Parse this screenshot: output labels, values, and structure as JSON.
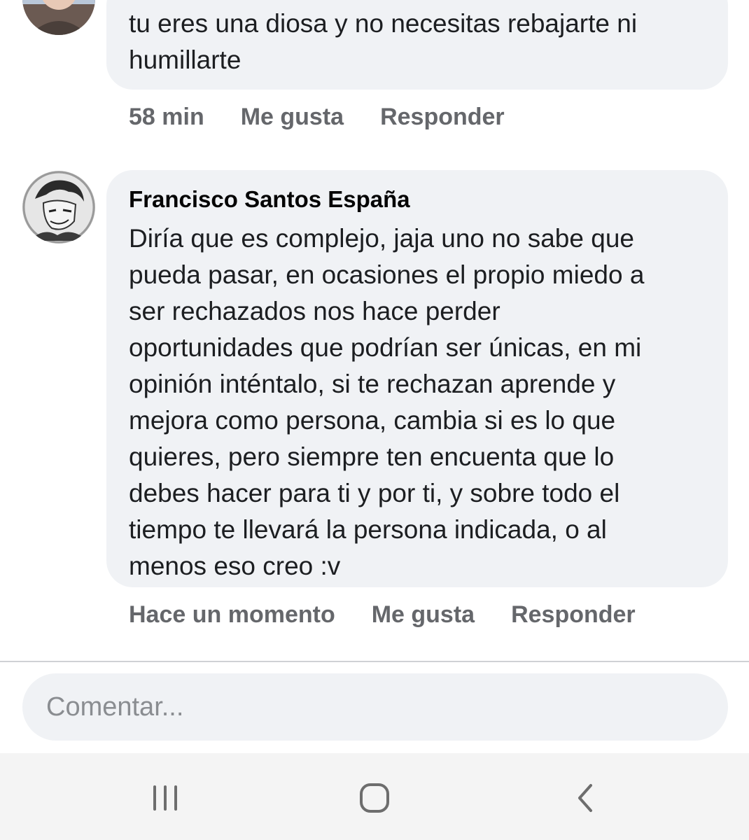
{
  "comments": [
    {
      "author": "",
      "text": "tu eres una diosa y no necesitas rebajarte ni\nhumillarte",
      "time": "58 min",
      "like_label": "Me gusta",
      "reply_label": "Responder"
    },
    {
      "author": "Francisco Santos España",
      "text": "Diría que es complejo, jaja uno no sabe que\npueda pasar, en ocasiones el propio miedo a\nser rechazados nos hace perder\noportunidades que podrían ser únicas, en mi\nopinión inténtalo, si te rechazan aprende y\nmejora como persona, cambia si es lo que\nquieres, pero siempre ten encuenta que lo\ndebes hacer para ti y por ti, y sobre todo el\ntiempo te llevará la persona indicada, o al\nmenos eso creo :v",
      "time": "Hace un momento",
      "like_label": "Me gusta",
      "reply_label": "Responder"
    }
  ],
  "composer": {
    "placeholder": "Comentar..."
  },
  "navbar": {
    "icons": [
      "recent-apps-icon",
      "home-icon",
      "back-icon"
    ]
  },
  "colors": {
    "bubble": "#f0f2f5",
    "meta_text": "#65676b",
    "nav_bg": "#f4f4f4"
  }
}
